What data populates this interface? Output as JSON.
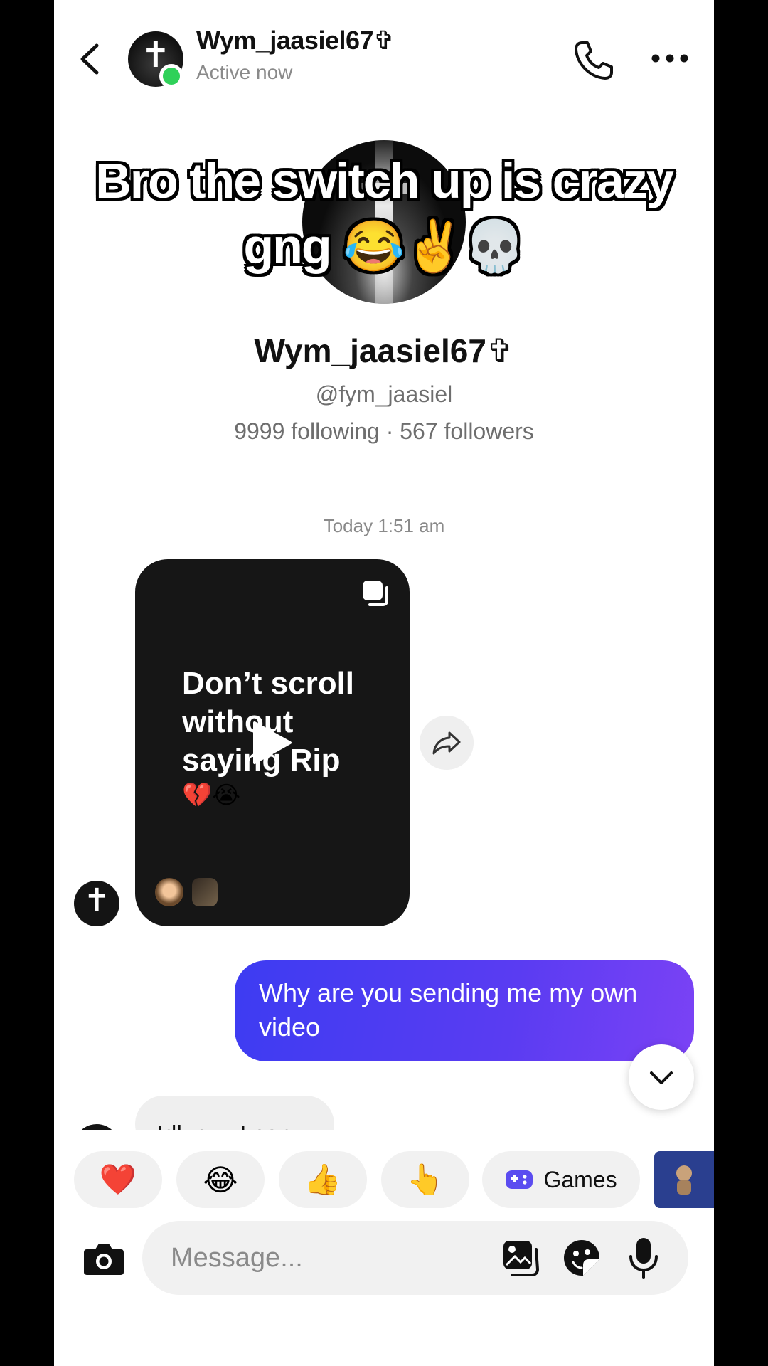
{
  "header": {
    "contact_name": "Wym_jaasiel67✞",
    "status": "Active now"
  },
  "overlay_caption": {
    "line1": "Bro the switch up is crazy",
    "line2": "gng 😂✌️💀"
  },
  "profile": {
    "name": "Wym_jaasiel67✞",
    "handle": "@fym_jaasiel",
    "stats": "9999 following · 567 followers"
  },
  "conversation": {
    "timestamp": "Today 1:51 am",
    "shared_video": {
      "text": "Don’t scroll without saying Rip",
      "emojis": "💔😭"
    },
    "outgoing_message": "Why are you sending me my own video",
    "incoming_partial": "Idk cuz I can"
  },
  "quick_reactions": {
    "heart": "❤️",
    "laugh": "😂",
    "thumbs_up": "👍",
    "point": "👆",
    "games_label": "Games"
  },
  "composer": {
    "placeholder": "Message..."
  },
  "colors": {
    "online": "#2fd159",
    "bubble_start": "#3d3cf2",
    "bubble_end": "#7b42f5"
  }
}
